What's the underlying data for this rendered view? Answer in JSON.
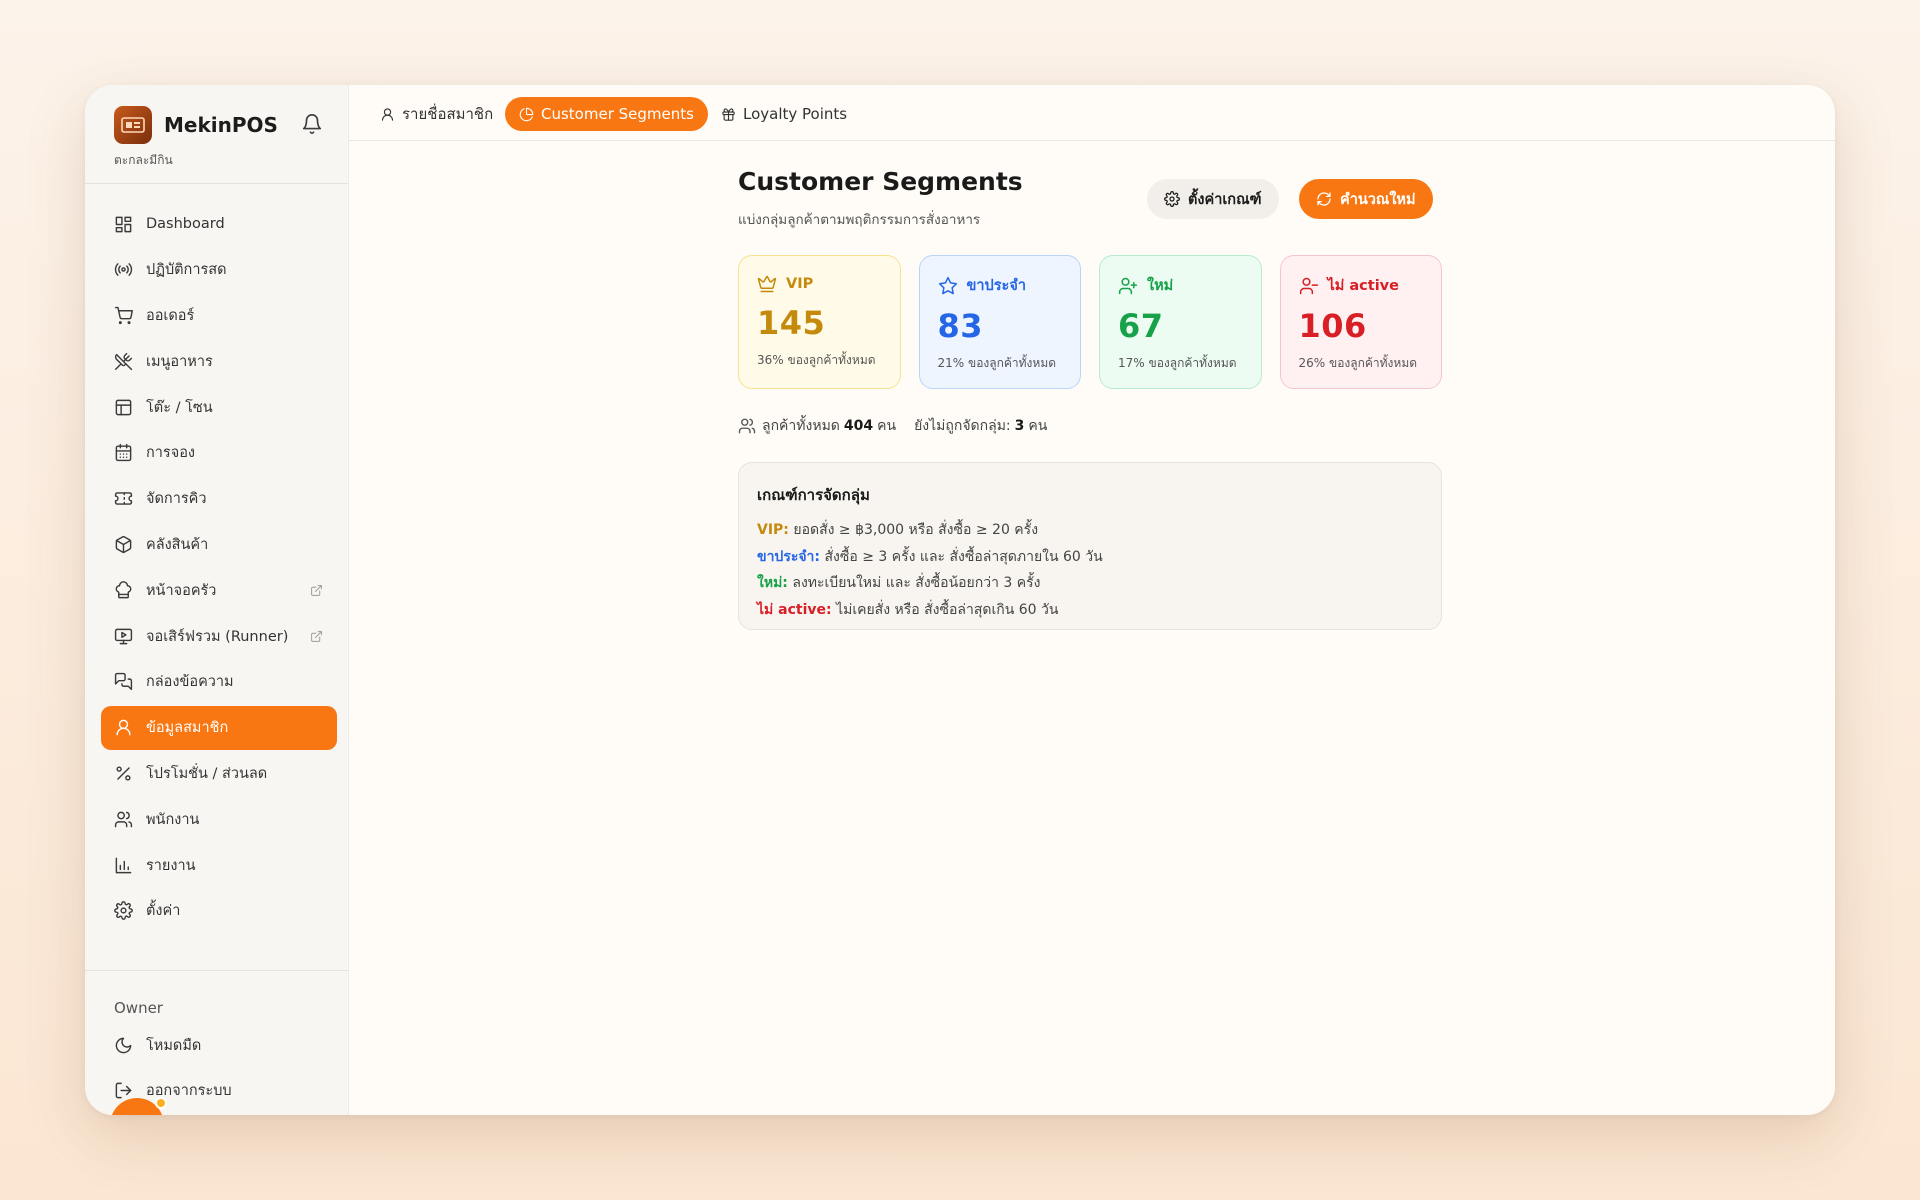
{
  "brand": {
    "name": "MekinPOS",
    "subtitle": "ตะกละมีกิน"
  },
  "sidebar": {
    "items": [
      {
        "label": "Dashboard",
        "icon": "dashboard-icon"
      },
      {
        "label": "ปฏิบัติการสด",
        "icon": "broadcast-icon"
      },
      {
        "label": "ออเดอร์",
        "icon": "cart-icon"
      },
      {
        "label": "เมนูอาหาร",
        "icon": "utensils-icon"
      },
      {
        "label": "โต๊ะ / โซน",
        "icon": "table-icon"
      },
      {
        "label": "การจอง",
        "icon": "calendar-icon"
      },
      {
        "label": "จัดการคิว",
        "icon": "ticket-icon"
      },
      {
        "label": "คลังสินค้า",
        "icon": "box-icon"
      },
      {
        "label": "หน้าจอครัว",
        "icon": "chef-hat-icon",
        "external": true
      },
      {
        "label": "จอเสิร์ฟรวม (Runner)",
        "icon": "monitor-icon",
        "external": true
      },
      {
        "label": "กล่องข้อความ",
        "icon": "messages-icon"
      },
      {
        "label": "ข้อมูลสมาชิก",
        "icon": "user-icon",
        "active": true
      },
      {
        "label": "โปรโมชั่น / ส่วนลด",
        "icon": "percent-icon"
      },
      {
        "label": "พนักงาน",
        "icon": "users-icon"
      },
      {
        "label": "รายงาน",
        "icon": "bar-chart-icon"
      },
      {
        "label": "ตั้งค่า",
        "icon": "gear-icon"
      }
    ],
    "role": "Owner",
    "bottom": [
      {
        "label": "โหมดมืด",
        "icon": "moon-icon"
      },
      {
        "label": "ออกจากระบบ",
        "icon": "logout-icon"
      }
    ]
  },
  "tabs": [
    {
      "label": "รายชื่อสมาชิก",
      "icon": "user-icon"
    },
    {
      "label": "Customer Segments",
      "icon": "pie-chart-icon",
      "active": true
    },
    {
      "label": "Loyalty Points",
      "icon": "gift-icon"
    }
  ],
  "page": {
    "title": "Customer Segments",
    "subtitle": "แบ่งกลุ่มลูกค้าตามพฤติกรรมการสั่งอาหาร",
    "settings_label": "ตั้งค่าเกณฑ์",
    "recalc_label": "คำนวณใหม่"
  },
  "segments": [
    {
      "name": "VIP",
      "value": "145",
      "pct": "36% ของลูกค้าทั้งหมด",
      "icon": "crown-icon",
      "color": "#c48a0c"
    },
    {
      "name": "ขาประจำ",
      "value": "83",
      "pct": "21% ของลูกค้าทั้งหมด",
      "icon": "star-icon",
      "color": "#2566e6"
    },
    {
      "name": "ใหม่",
      "value": "67",
      "pct": "17% ของลูกค้าทั้งหมด",
      "icon": "user-plus-icon",
      "color": "#17a24a"
    },
    {
      "name": "ไม่ active",
      "value": "106",
      "pct": "26% ของลูกค้าทั้งหมด",
      "icon": "user-minus-icon",
      "color": "#d81f26"
    }
  ],
  "totals": {
    "total_label": "ลูกค้าทั้งหมด",
    "total_value": "404",
    "unit": "คน",
    "unassigned_label": "ยังไม่ถูกจัดกลุ่ม:",
    "unassigned_value": "3"
  },
  "rules": {
    "title": "เกณฑ์การจัดกลุ่ม",
    "items": [
      {
        "key": "VIP:",
        "text": "ยอดสั่ง ≥ ฿3,000 หรือ สั่งซื้อ ≥ 20 ครั้ง",
        "color": "#c48a0c"
      },
      {
        "key": "ขาประจำ:",
        "text": "สั่งซื้อ ≥ 3 ครั้ง และ สั่งซื้อล่าสุดภายใน 60 วัน",
        "color": "#2566e6"
      },
      {
        "key": "ใหม่:",
        "text": "ลงทะเบียนใหม่ และ สั่งซื้อน้อยกว่า 3 ครั้ง",
        "color": "#17a24a"
      },
      {
        "key": "ไม่ active:",
        "text": "ไม่เคยสั่ง หรือ สั่งซื้อล่าสุดเกิน 60 วัน",
        "color": "#d81f26"
      }
    ]
  },
  "colors": {
    "accent": "#f97712"
  }
}
